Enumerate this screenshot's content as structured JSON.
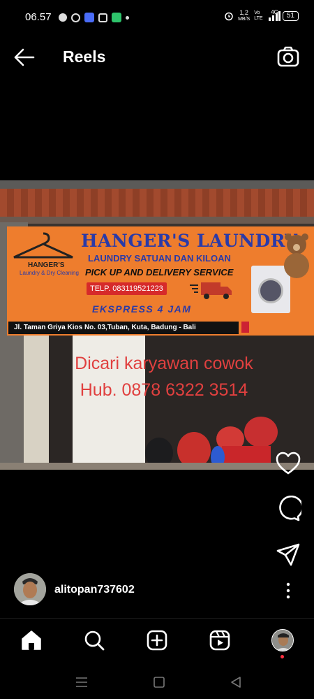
{
  "status_bar": {
    "time": "06.57",
    "net_speed_value": "1,2",
    "net_speed_unit": "MB/S",
    "volte": "Vo LTE",
    "network": "4G",
    "battery": "51"
  },
  "header": {
    "title": "Reels"
  },
  "video": {
    "banner_title": "HANGER'S LAUNDRY",
    "banner_subtitle": "LAUNDRY SATUAN DAN KILOAN",
    "banner_service": "PICK UP AND DELIVERY SERVICE",
    "banner_phone": "TELP. 083119521223",
    "banner_express": "EKSPRESS 4 JAM",
    "logo_name": "HANGER'S",
    "logo_tagline": "Laundry & Dry Cleaning",
    "banner_address": "Jl. Taman Griya Kios No. 03,Tuban, Kuta, Badung - Bali",
    "overlay_line1": "Dicari karyawan cowok",
    "overlay_line2": "Hub. 0878 6322 3514"
  },
  "actions": {
    "like_icon": "heart-icon",
    "comment_icon": "comment-icon",
    "share_icon": "send-icon",
    "more_icon": "more-vertical-icon"
  },
  "author": {
    "username": "alitopan737602"
  },
  "bottom_nav": {
    "items": [
      "home-icon",
      "search-icon",
      "create-icon",
      "reels-icon",
      "profile-avatar"
    ]
  },
  "colors": {
    "background": "#000000",
    "overlay_text": "#e0403f",
    "banner_orange": "#ee7d2d",
    "banner_blue": "#2a3aa8",
    "notification_dot": "#ff3040"
  }
}
